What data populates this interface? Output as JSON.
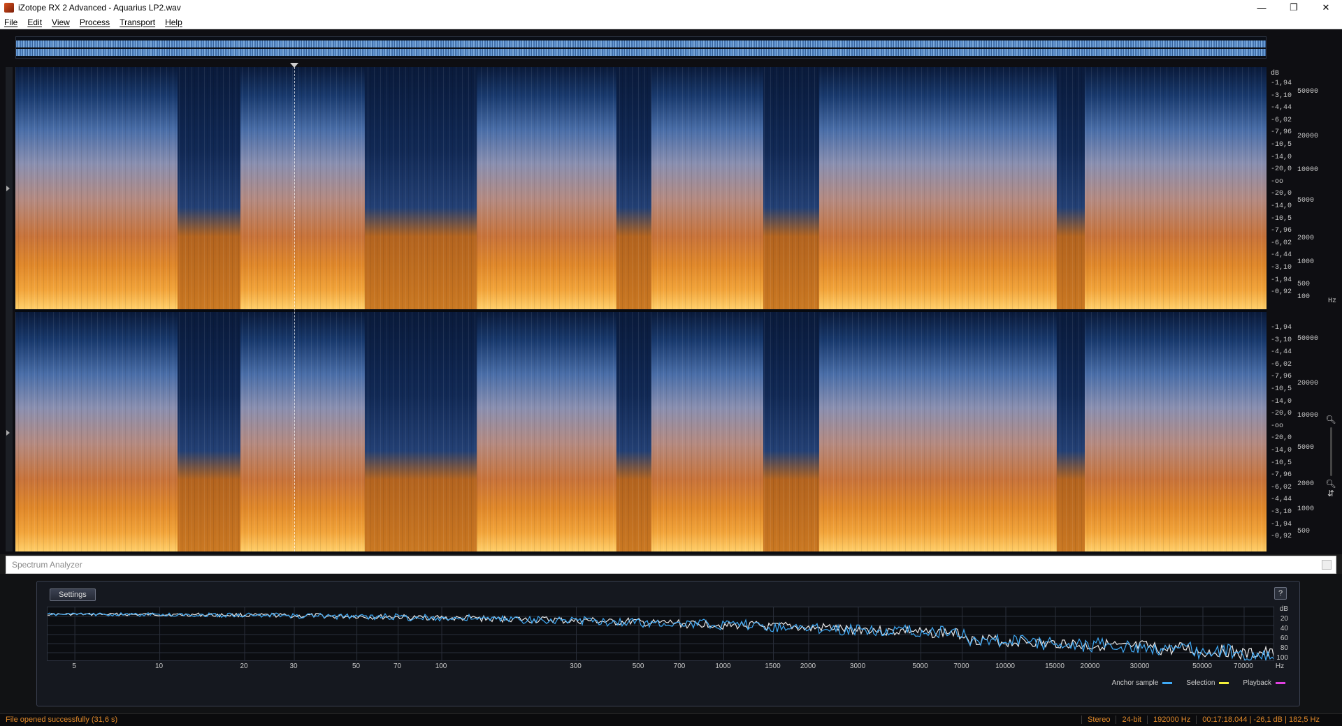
{
  "window": {
    "title": "iZotope RX 2 Advanced - Aquarius LP2.wav",
    "minimize": "—",
    "restore": "❐",
    "close": "✕"
  },
  "menu": [
    "File",
    "Edit",
    "View",
    "Process",
    "Transport",
    "Help"
  ],
  "spectrogram": {
    "db_unit": "dB",
    "hz_unit": "Hz",
    "top_channel_db": [
      "-1,94",
      "-3,10",
      "-4,44",
      "-6,02",
      "-7,96",
      "-10,5",
      "-14,0",
      "-20,0",
      "-oo",
      "-20,0",
      "-14,0",
      "-10,5",
      "-7,96",
      "-6,02",
      "-4,44",
      "-3,10",
      "-1,94",
      "-0,92"
    ],
    "top_channel_hz": [
      "50000",
      "20000",
      "10000",
      "5000",
      "2000",
      "1000",
      "500",
      "100"
    ],
    "bottom_channel_db": [
      "-1,94",
      "-3,10",
      "-4,44",
      "-6,02",
      "-7,96",
      "-10,5",
      "-14,0",
      "-20,0",
      "-oo",
      "-20,0",
      "-14,0",
      "-10,5",
      "-7,96",
      "-6,02",
      "-4,44",
      "-3,10",
      "-1,94",
      "-0,92"
    ],
    "bottom_channel_hz": [
      "50000",
      "20000",
      "10000",
      "5000",
      "2000",
      "1000",
      "500"
    ]
  },
  "spectrum_analyzer": {
    "title": "Spectrum Analyzer",
    "settings_label": "Settings",
    "help_label": "?",
    "db_label": "dB",
    "db_ticks": [
      "20",
      "40",
      "60",
      "80",
      "100"
    ],
    "hz_ticks": [
      "5",
      "10",
      "20",
      "30",
      "50",
      "70",
      "100",
      "300",
      "500",
      "700",
      "1000",
      "1500",
      "2000",
      "3000",
      "5000",
      "7000",
      "10000",
      "15000",
      "20000",
      "30000",
      "50000",
      "70000",
      "Hz"
    ],
    "legend": [
      {
        "label": "Anchor sample",
        "color": "#3fa9f5"
      },
      {
        "label": "Selection",
        "color": "#f3ef3a"
      },
      {
        "label": "Playback",
        "color": "#e040e0"
      }
    ]
  },
  "status": {
    "message": "File opened successfully (31,6 s)",
    "channels": "Stereo",
    "bit_depth": "24-bit",
    "sample_rate": "192000 Hz",
    "cursor": "00:17:18.044 | -26,1 dB | 182,5 Hz"
  }
}
